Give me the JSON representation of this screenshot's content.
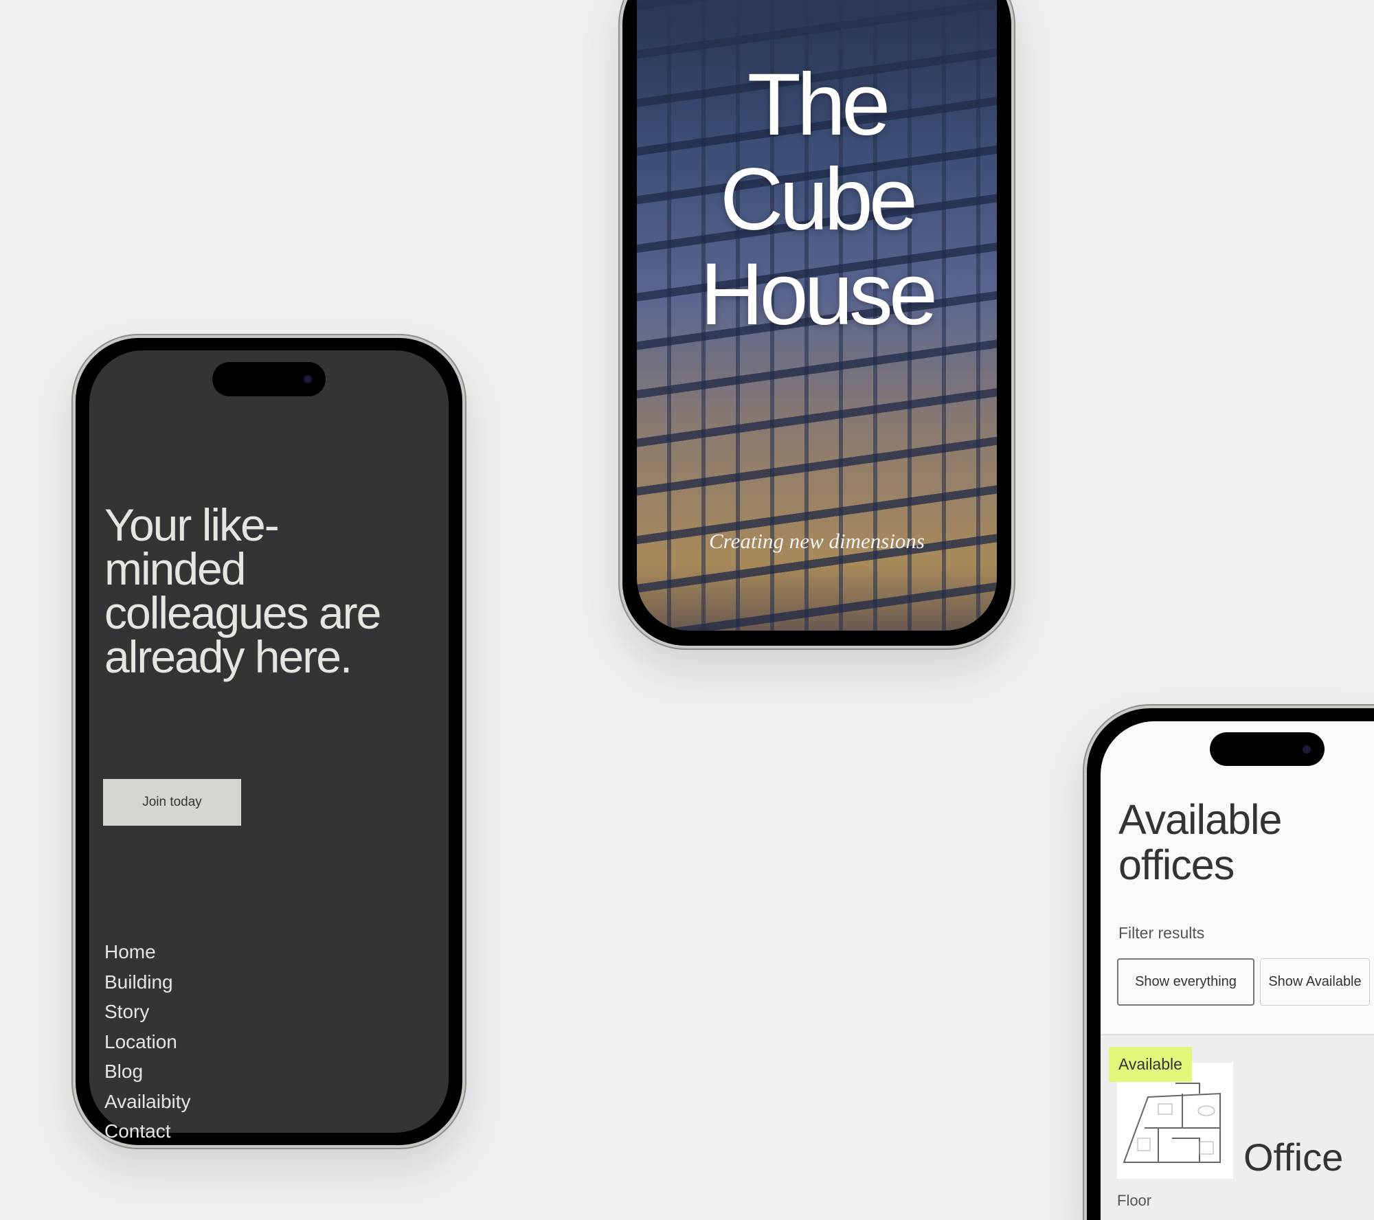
{
  "left_phone": {
    "headline": "Your like-minded colleagues are already here.",
    "cta_label": "Join today",
    "nav": [
      "Home",
      "Building",
      "Story",
      "Location",
      "Blog",
      "Availaibity",
      "Contact"
    ]
  },
  "middle_phone": {
    "title_lines": [
      "The",
      "Cube",
      "House"
    ],
    "tagline": "Creating new dimensions"
  },
  "right_phone": {
    "title": "Available offices",
    "filter_label": "Filter results",
    "filters": [
      "Show everything",
      "Show Available"
    ],
    "listing": {
      "status": "Available",
      "name": "Office",
      "floor_label": "Floor"
    },
    "badge_color": "#e3f77a"
  }
}
